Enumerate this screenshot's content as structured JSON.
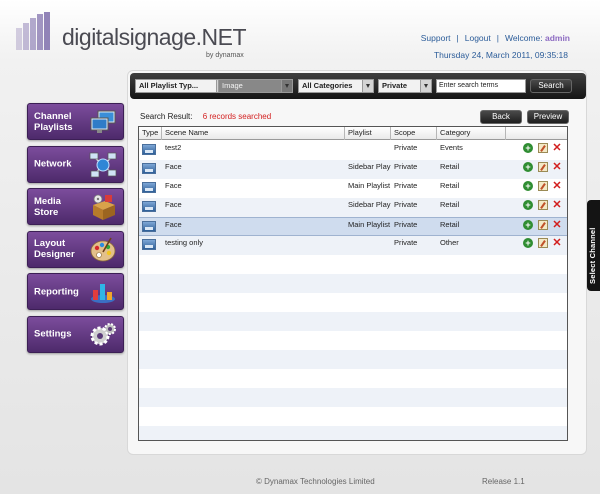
{
  "brand": {
    "name": "digitalsignage.NET",
    "by": "by dynamax"
  },
  "header": {
    "support": "Support",
    "logout": "Logout",
    "welcome": "Welcome:",
    "user": "admin",
    "datetime": "Thursday 24, March 2011, 09:35:18"
  },
  "nav": {
    "items": [
      {
        "label": "Channel Playlists",
        "icon": "monitors-icon"
      },
      {
        "label": "Network",
        "icon": "network-icon"
      },
      {
        "label": "Media Store",
        "icon": "media-box-icon"
      },
      {
        "label": "Layout Designer",
        "icon": "palette-icon"
      },
      {
        "label": "Reporting",
        "icon": "chart-icon"
      },
      {
        "label": "Settings",
        "icon": "gears-icon"
      }
    ]
  },
  "filters": {
    "playlist": "All Playlist Typ...",
    "media": "Image",
    "category": "All Categories",
    "scope": "Private",
    "search_placeholder": "Enter search terms",
    "search_button": "Search"
  },
  "results": {
    "label": "Search Result:",
    "count": "6 records searched",
    "back": "Back",
    "preview": "Preview"
  },
  "table": {
    "columns": [
      "Type",
      "Scene Name",
      "Playlist",
      "Scope",
      "Category"
    ],
    "rows": [
      {
        "name": "test2",
        "playlist": "",
        "scope": "Private",
        "category": "Events"
      },
      {
        "name": "Face",
        "playlist": "Sidebar Play",
        "scope": "Private",
        "category": "Retail"
      },
      {
        "name": "Face",
        "playlist": "Main Playlist",
        "scope": "Private",
        "category": "Retail"
      },
      {
        "name": "Face",
        "playlist": "Sidebar Play",
        "scope": "Private",
        "category": "Retail"
      },
      {
        "name": "Face",
        "playlist": "Main Playlist",
        "scope": "Private",
        "category": "Retail"
      },
      {
        "name": "testing only",
        "playlist": "",
        "scope": "Private",
        "category": "Other"
      }
    ]
  },
  "side_tab": "Select Channel",
  "footer": {
    "copyright": "© Dynamax Technologies Limited",
    "release": "Release 1.1"
  },
  "colors": {
    "nav_purple": "#5e3680",
    "link_blue": "#2b5c99",
    "count_red": "#d32020",
    "selected_row": "#cfdcee"
  }
}
